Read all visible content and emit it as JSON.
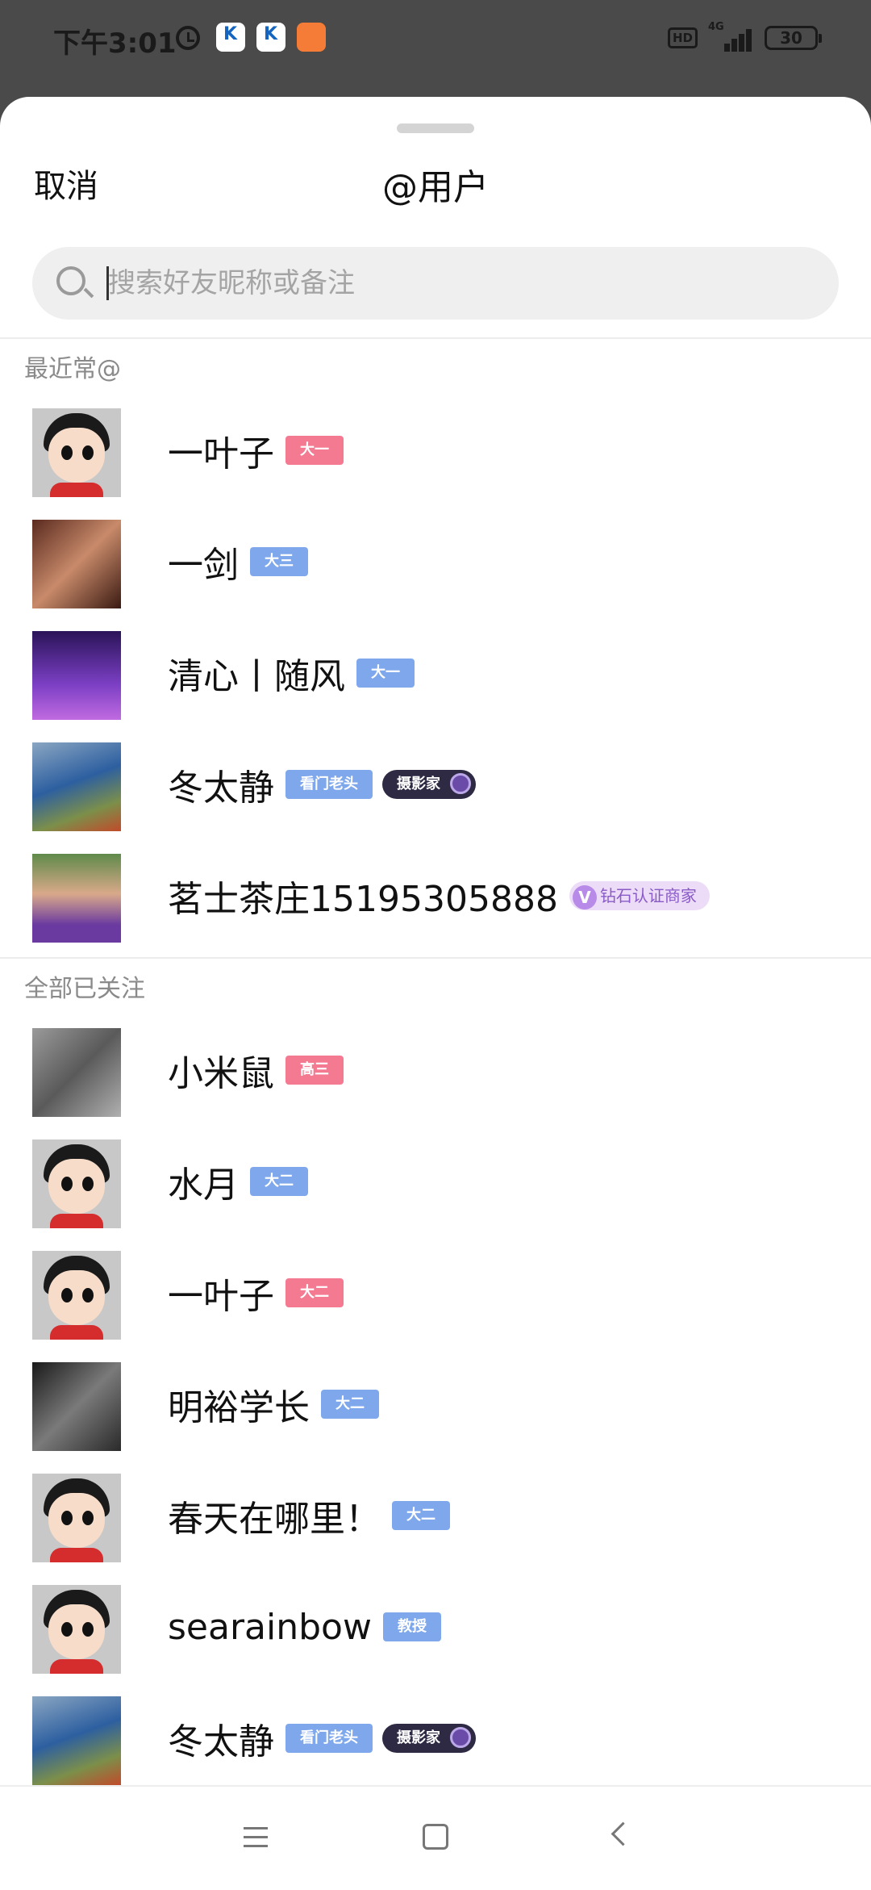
{
  "status_bar": {
    "time": "下午3:01",
    "network": "4G",
    "hd": "HD",
    "battery": "30"
  },
  "header": {
    "cancel_label": "取消",
    "title": "@用户"
  },
  "search": {
    "placeholder": "搜索好友昵称或备注",
    "value": ""
  },
  "sections": [
    {
      "label": "最近常@",
      "users": [
        {
          "name": "一叶子",
          "badge": "大一",
          "badge_color": "#f47a92",
          "avatar": "cartoon"
        },
        {
          "name": "一剑",
          "badge": "大三",
          "badge_color": "#7fa8ec",
          "avatar": "photo-face-old"
        },
        {
          "name": "清心丨随风",
          "badge": "大一",
          "badge_color": "#7fa8ec",
          "avatar": "photo-purple"
        },
        {
          "name": "冬太静",
          "badge": "看门老头",
          "badge_color": "#7fa8ec",
          "extra_badge": "摄影家",
          "avatar": "photo-photographer"
        },
        {
          "name": "茗士茶庄15195305888",
          "badge": "钻石认证商家",
          "badge_color": "#ecdcf7",
          "badge_prefix": "V",
          "avatar": "photo-man"
        }
      ]
    },
    {
      "label": "全部已关注",
      "users": [
        {
          "name": "小米鼠",
          "badge": "高三",
          "badge_color": "#f47a92",
          "avatar": "photo-mickey"
        },
        {
          "name": "水月",
          "badge": "大二",
          "badge_color": "#7fa8ec",
          "avatar": "cartoon"
        },
        {
          "name": "一叶子",
          "badge": "大二",
          "badge_color": "#f47a92",
          "avatar": "cartoon"
        },
        {
          "name": "明裕学长",
          "badge": "大二",
          "badge_color": "#7fa8ec",
          "avatar": "photo-bw"
        },
        {
          "name": "春天在哪里！",
          "badge": "大二",
          "badge_color": "#7fa8ec",
          "avatar": "cartoon"
        },
        {
          "name": "searainbow",
          "badge": "教授",
          "badge_color": "#7fa8ec",
          "avatar": "cartoon-girl"
        },
        {
          "name": "冬太静",
          "badge": "看门老头",
          "badge_color": "#7fa8ec",
          "extra_badge": "摄影家",
          "avatar": "photo-photographer"
        }
      ]
    }
  ],
  "nav": {
    "menu_icon": "menu-icon",
    "home_icon": "home-icon",
    "back_icon": "back-icon"
  }
}
